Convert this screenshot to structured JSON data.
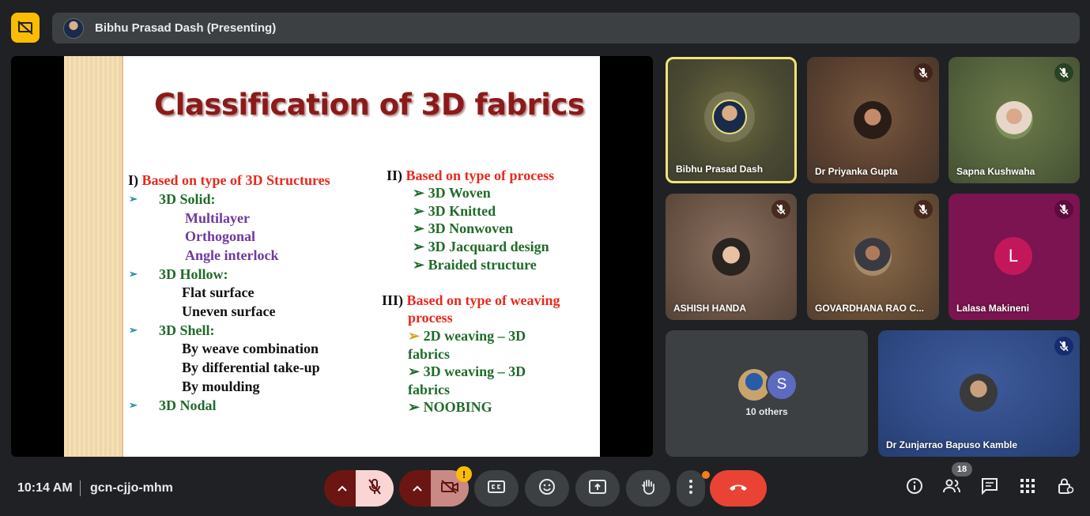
{
  "header": {
    "presenter_label": "Bibhu Prasad Dash (Presenting)"
  },
  "slide": {
    "title": "Classification of 3D fabrics",
    "left_column": [
      {
        "segments": [
          {
            "text": "I) ",
            "color": "black"
          },
          {
            "text": "Based on type of 3D Structures",
            "color": "red"
          }
        ]
      },
      {
        "bullet": true,
        "segments": [
          {
            "text": "3D Solid:",
            "color": "green"
          }
        ]
      },
      {
        "segments": [
          {
            "text": "Multilayer",
            "color": "purple"
          }
        ]
      },
      {
        "segments": [
          {
            "text": "Orthogonal",
            "color": "purple"
          }
        ]
      },
      {
        "segments": [
          {
            "text": "Angle interlock",
            "color": "purple"
          }
        ]
      },
      {
        "bullet": true,
        "segments": [
          {
            "text": "3D Hollow:",
            "color": "green"
          }
        ]
      },
      {
        "segments": [
          {
            "text": "Flat surface",
            "color": "black"
          }
        ]
      },
      {
        "segments": [
          {
            "text": "Uneven surface",
            "color": "black"
          }
        ]
      },
      {
        "bullet": true,
        "segments": [
          {
            "text": "3D Shell:",
            "color": "green"
          }
        ]
      },
      {
        "segments": [
          {
            "text": "By weave combination",
            "color": "black"
          }
        ]
      },
      {
        "segments": [
          {
            "text": "By differential take-up",
            "color": "black"
          }
        ]
      },
      {
        "segments": [
          {
            "text": "By moulding",
            "color": "black"
          }
        ]
      },
      {
        "bullet": true,
        "segments": [
          {
            "text": "3D Nodal",
            "color": "green"
          }
        ]
      }
    ],
    "right_column_a": [
      {
        "segments": [
          {
            "text": "II) ",
            "color": "black"
          },
          {
            "text": "Based on type of process",
            "color": "red"
          }
        ]
      },
      {
        "segments": [
          {
            "text": "➢ 3D Woven",
            "color": "green"
          }
        ]
      },
      {
        "segments": [
          {
            "text": "➢ 3D Knitted",
            "color": "green"
          }
        ]
      },
      {
        "segments": [
          {
            "text": "➢ 3D Nonwoven",
            "color": "green"
          }
        ]
      },
      {
        "segments": [
          {
            "text": "➢ 3D Jacquard design",
            "color": "green"
          }
        ]
      },
      {
        "segments": [
          {
            "text": "➢ Braided structure",
            "color": "green"
          }
        ]
      }
    ],
    "right_column_b": [
      {
        "segments": [
          {
            "text": "III) ",
            "color": "black"
          },
          {
            "text": "Based on type of weaving",
            "color": "red"
          }
        ]
      },
      {
        "segments": [
          {
            "text": "process",
            "color": "red"
          }
        ]
      },
      {
        "segments": [
          {
            "text": "➢ ",
            "color": "gold"
          },
          {
            "text": "2D weaving – 3D",
            "color": "green"
          }
        ]
      },
      {
        "segments": [
          {
            "text": "fabrics",
            "color": "green"
          }
        ]
      },
      {
        "segments": [
          {
            "text": "➢ 3D weaving – 3D",
            "color": "green"
          }
        ]
      },
      {
        "segments": [
          {
            "text": "fabrics",
            "color": "green"
          }
        ]
      },
      {
        "segments": [
          {
            "text": "➢ NOOBING",
            "color": "green"
          }
        ]
      }
    ]
  },
  "participants": [
    {
      "name": "Bibhu Prasad Dash",
      "active": true
    },
    {
      "name": "Dr Priyanka Gupta",
      "muted": true
    },
    {
      "name": "Sapna Kushwaha",
      "muted": true
    },
    {
      "name": "ASHISH HANDA",
      "muted": true
    },
    {
      "name": "GOVARDHANA RAO C...",
      "muted": true
    },
    {
      "name": "Lalasa Makineni",
      "muted": true,
      "initial": "L"
    },
    {
      "name": "Dr Zunjarrao Bapuso Kamble",
      "muted": true
    }
  ],
  "others_tile": {
    "label": "10 others",
    "initial": "S"
  },
  "footer": {
    "time": "10:14 AM",
    "meeting_code": "gcn-cjjo-mhm",
    "participant_count": "18",
    "camera_warning": "!"
  },
  "colors": {
    "black": "#111111",
    "red": "#e8291c",
    "green": "#1f6b2a",
    "purple": "#6e3aa0",
    "gold": "#d6a21a",
    "hangup": "#ea4335",
    "presenting_badge": "#fbbc04"
  }
}
